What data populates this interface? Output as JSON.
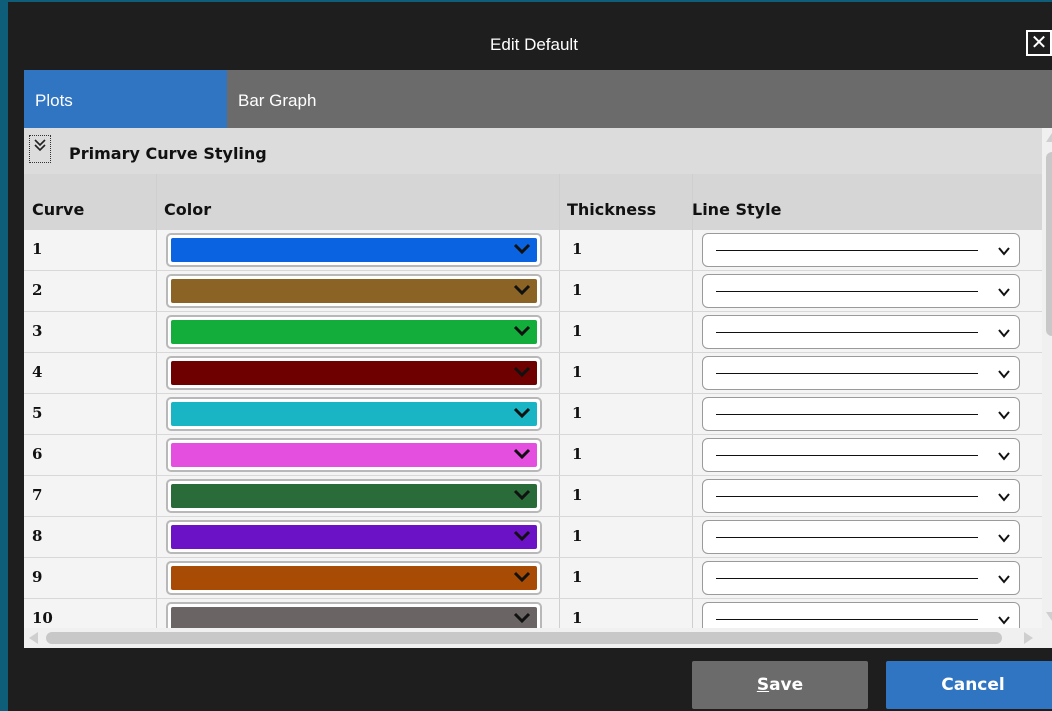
{
  "dialog": {
    "title": "Edit Default",
    "close_label": "✕"
  },
  "tabs": [
    {
      "label": "Plots",
      "active": true
    },
    {
      "label": "Bar Graph",
      "active": false
    }
  ],
  "section": {
    "title": "Primary Curve Styling",
    "collapse_icon": "double-chevron-down-icon"
  },
  "columns": {
    "curve": "Curve",
    "color": "Color",
    "thickness": "Thickness",
    "line_style": "Line Style"
  },
  "rows": [
    {
      "curve": "1",
      "color": "#0a63e0",
      "thickness": "1",
      "line_style": "solid"
    },
    {
      "curve": "2",
      "color": "#8b6425",
      "thickness": "1",
      "line_style": "solid"
    },
    {
      "curve": "3",
      "color": "#12ad3a",
      "thickness": "1",
      "line_style": "solid"
    },
    {
      "curve": "4",
      "color": "#6e0000",
      "thickness": "1",
      "line_style": "solid"
    },
    {
      "curve": "5",
      "color": "#19b5c4",
      "thickness": "1",
      "line_style": "solid"
    },
    {
      "curve": "6",
      "color": "#e54fe0",
      "thickness": "1",
      "line_style": "solid"
    },
    {
      "curve": "7",
      "color": "#2a6b3a",
      "thickness": "1",
      "line_style": "solid"
    },
    {
      "curve": "8",
      "color": "#6c12c6",
      "thickness": "1",
      "line_style": "solid"
    },
    {
      "curve": "9",
      "color": "#a84b05",
      "thickness": "1",
      "line_style": "solid"
    },
    {
      "curve": "10",
      "color": "#6a6464",
      "thickness": "1",
      "line_style": "solid"
    }
  ],
  "footer": {
    "save_mnemonic": "S",
    "save_rest": "ave",
    "cancel_label": "Cancel"
  },
  "colors": {
    "accent": "#2f75c2",
    "tab_bar": "#6b6b6b",
    "background": "#1e1e1e"
  }
}
